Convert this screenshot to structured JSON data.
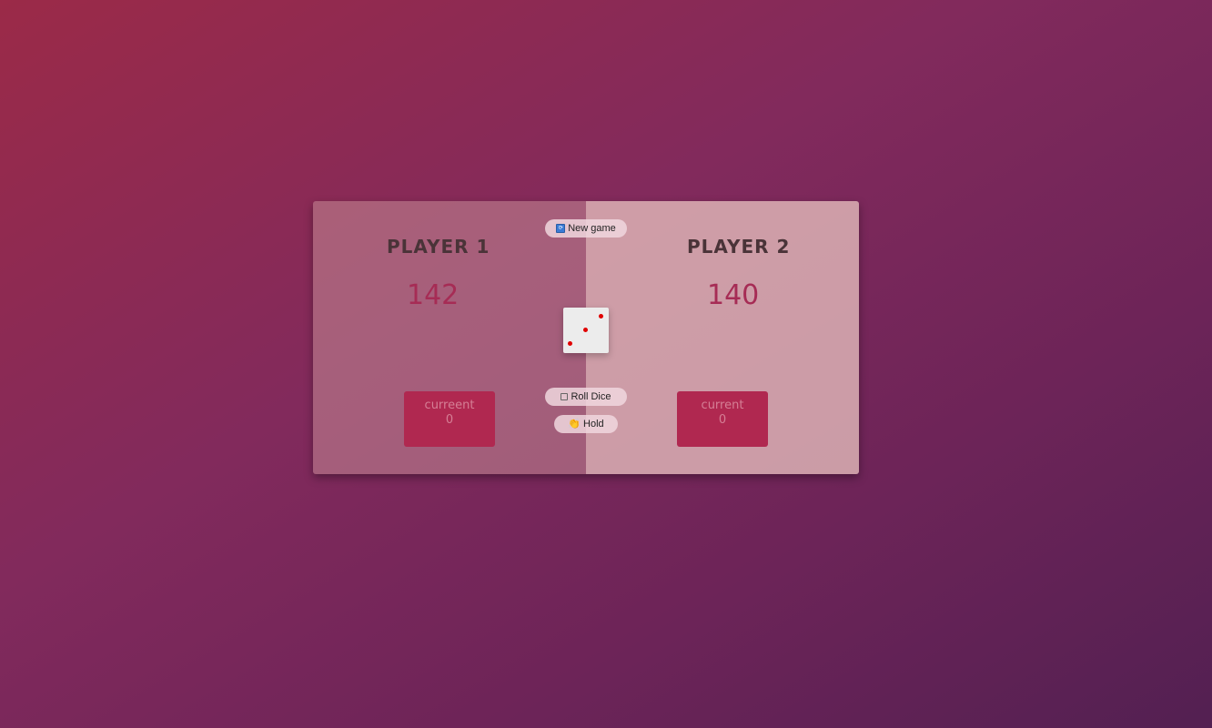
{
  "players": [
    {
      "name": "PLAYER 1",
      "score": "142",
      "current_label": "curreent",
      "current_score": "0"
    },
    {
      "name": "PLAYER 2",
      "score": "140",
      "current_label": "current",
      "current_score": "0"
    }
  ],
  "buttons": {
    "new_game": "New game",
    "roll_dice": "Roll Dice",
    "hold": "Hold"
  },
  "dice": {
    "value": 3,
    "pip_color": "#e00000"
  },
  "icons": {
    "new_game": "new-game-icon",
    "roll_dice": "dice-icon",
    "hold": "hand-icon"
  },
  "colors": {
    "score": "#a62c55",
    "current_box": "#b02850"
  }
}
